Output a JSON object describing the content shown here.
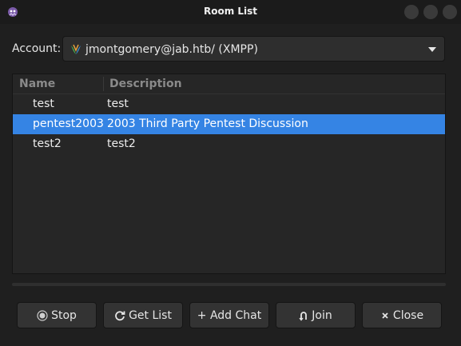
{
  "window": {
    "title": "Room List"
  },
  "account": {
    "label": "Account:",
    "value": "jmontgomery@jab.htb/ (XMPP)"
  },
  "room_list": {
    "columns": [
      "Name",
      "Description"
    ],
    "rows": [
      {
        "name": "test",
        "description": "test",
        "selected": false
      },
      {
        "name": "pentest2003",
        "description": "2003 Third Party Pentest Discussion",
        "selected": true
      },
      {
        "name": "test2",
        "description": "test2",
        "selected": false
      }
    ]
  },
  "buttons": {
    "stop": "Stop",
    "get_list": "Get List",
    "add_chat": "+ Add Chat",
    "join": "Join",
    "close": "Close"
  },
  "colors": {
    "selection": "#3584e4",
    "background": "#1f1f1f"
  }
}
